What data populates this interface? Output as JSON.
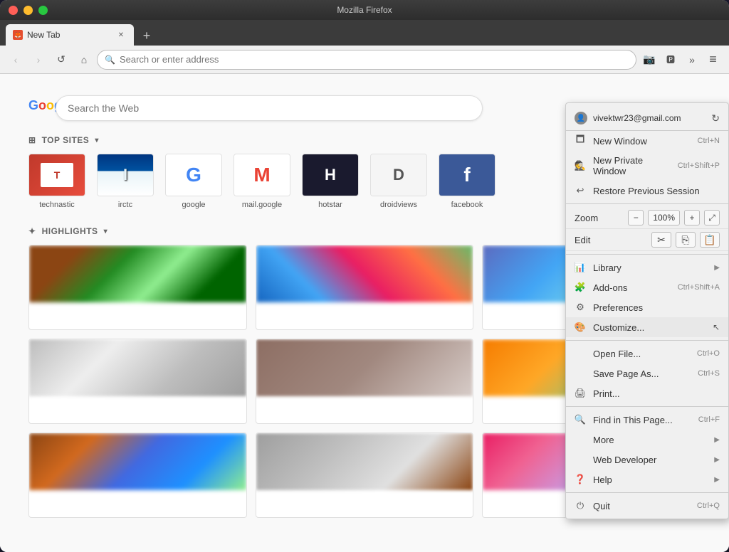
{
  "window": {
    "title": "Mozilla Firefox"
  },
  "titlebar": {
    "buttons": {
      "close": "●",
      "minimize": "●",
      "maximize": "●"
    }
  },
  "tabs": [
    {
      "title": "New Tab",
      "active": true
    }
  ],
  "new_tab_button": "+",
  "navbar": {
    "back": "‹",
    "forward": "›",
    "reload": "↺",
    "home": "⌂",
    "address_placeholder": "Search or enter address",
    "address_value": ""
  },
  "newtab": {
    "search_placeholder": "Search the Web",
    "top_sites_label": "TOP SITES",
    "highlights_label": "HIGHLIGHTS",
    "sites": [
      {
        "name": "technastic",
        "icon": "T"
      },
      {
        "name": "irctc",
        "icon": "I"
      },
      {
        "name": "google",
        "icon": "G"
      },
      {
        "name": "mail.google",
        "icon": "M"
      },
      {
        "name": "hotstar",
        "icon": "H"
      },
      {
        "name": "droidviews",
        "icon": "D"
      },
      {
        "name": "facebook",
        "icon": "f"
      }
    ]
  },
  "menu": {
    "user_email": "vivektwr23@gmail.com",
    "items": [
      {
        "id": "new-window",
        "label": "New Window",
        "shortcut": "Ctrl+N",
        "icon": "🗖"
      },
      {
        "id": "new-private-window",
        "label": "New Private Window",
        "shortcut": "Ctrl+Shift+P",
        "icon": "🕵"
      },
      {
        "id": "restore-session",
        "label": "Restore Previous Session",
        "shortcut": "",
        "icon": "🔄"
      },
      {
        "id": "zoom",
        "label": "Zoom",
        "value": "100%",
        "type": "zoom"
      },
      {
        "id": "edit",
        "label": "Edit",
        "type": "edit"
      },
      {
        "id": "library",
        "label": "Library",
        "shortcut": "",
        "icon": "📚",
        "arrow": true
      },
      {
        "id": "addons",
        "label": "Add-ons",
        "shortcut": "Ctrl+Shift+A",
        "icon": "🧩"
      },
      {
        "id": "preferences",
        "label": "Preferences",
        "shortcut": "",
        "icon": "⚙"
      },
      {
        "id": "customize",
        "label": "Customize...",
        "shortcut": "",
        "icon": "🎨"
      },
      {
        "id": "open-file",
        "label": "Open File...",
        "shortcut": "Ctrl+O",
        "icon": ""
      },
      {
        "id": "save-page",
        "label": "Save Page As...",
        "shortcut": "Ctrl+S",
        "icon": ""
      },
      {
        "id": "print",
        "label": "Print...",
        "shortcut": "",
        "icon": "🖨"
      },
      {
        "id": "find-in-page",
        "label": "Find in This Page...",
        "shortcut": "Ctrl+F",
        "icon": "🔍"
      },
      {
        "id": "more",
        "label": "More",
        "shortcut": "",
        "icon": "",
        "arrow": true
      },
      {
        "id": "web-developer",
        "label": "Web Developer",
        "shortcut": "",
        "icon": "",
        "arrow": true
      },
      {
        "id": "help",
        "label": "Help",
        "shortcut": "",
        "icon": "❓",
        "arrow": true
      },
      {
        "id": "quit",
        "label": "Quit",
        "shortcut": "Ctrl+Q",
        "icon": "⏻"
      }
    ],
    "zoom_value": "100%"
  }
}
